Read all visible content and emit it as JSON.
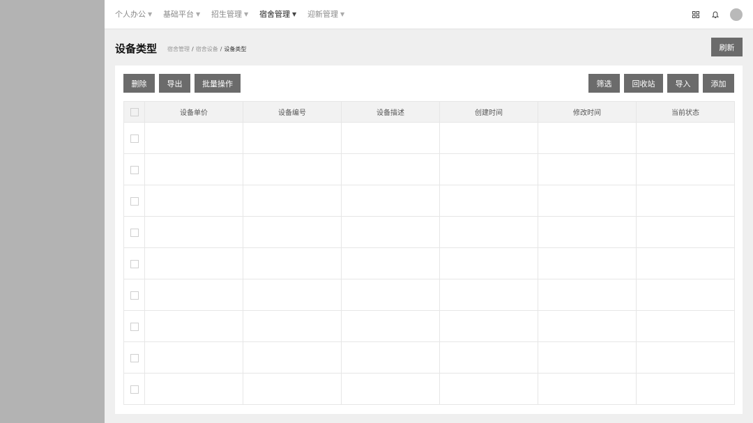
{
  "nav": {
    "items": [
      {
        "label": "个人办公"
      },
      {
        "label": "基础平台"
      },
      {
        "label": "招生管理"
      },
      {
        "label": "宿舍管理"
      },
      {
        "label": "迎新管理"
      }
    ],
    "active_label": "宿舍管理",
    "icons": [
      "grid-icon",
      "bell-icon",
      "avatar"
    ]
  },
  "page": {
    "title": "设备类型",
    "breadcrumb": [
      "宿舍管理",
      "宿舍设备",
      "设备类型"
    ],
    "refresh_label": "刷新"
  },
  "toolbar": {
    "left": [
      "删除",
      "导出",
      "批量操作"
    ],
    "right": [
      "筛选",
      "回收站",
      "导入",
      "添加"
    ]
  },
  "table": {
    "columns": [
      "设备单价",
      "设备编号",
      "设备描述",
      "创建时间",
      "修改时间",
      "当前状态"
    ],
    "row_count": 9
  },
  "colors": {
    "button_bg": "#6b6b6b",
    "sidebar_bg": "#b3b3b3",
    "content_bg": "#efefef"
  }
}
